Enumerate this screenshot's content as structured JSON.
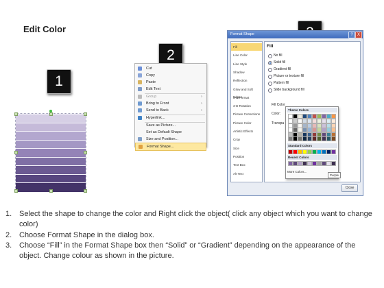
{
  "title": "Edit Color",
  "badges": [
    "1",
    "2",
    "3"
  ],
  "stack_colors": [
    "#d6cfe5",
    "#c5bad9",
    "#b3a7cf",
    "#a497c4",
    "#9483b7",
    "#7f6fa5",
    "#6b5a92",
    "#57467f",
    "#433368"
  ],
  "context_menu": {
    "items": [
      {
        "label": "Cut",
        "icon": "scissors-icon",
        "disabled": false,
        "submenu": false,
        "color": "#6b8fd8"
      },
      {
        "label": "Copy",
        "icon": "copy-icon",
        "disabled": false,
        "submenu": false,
        "color": "#8aa5d8"
      },
      {
        "label": "Paste",
        "icon": "paste-icon",
        "disabled": false,
        "submenu": false,
        "color": "#d8b460"
      },
      {
        "label": "Edit Text",
        "icon": "edit-text-icon",
        "disabled": false,
        "submenu": false,
        "color": "#7d9bc8"
      },
      {
        "label": "Group",
        "icon": "group-icon",
        "disabled": true,
        "submenu": true,
        "color": "#bbbbbb"
      },
      {
        "label": "Bring to Front",
        "icon": "bring-to-front-icon",
        "disabled": false,
        "submenu": true,
        "color": "#6f9ad0"
      },
      {
        "label": "Send to Back",
        "icon": "send-to-back-icon",
        "disabled": false,
        "submenu": true,
        "color": "#6f9ad0"
      },
      {
        "label": "Hyperlink...",
        "icon": "hyperlink-icon",
        "disabled": false,
        "submenu": false,
        "color": "#3f82c6"
      },
      {
        "label": "Save as Picture...",
        "icon": "",
        "disabled": false,
        "submenu": false,
        "color": ""
      },
      {
        "label": "Set as Default Shape",
        "icon": "",
        "disabled": false,
        "submenu": false,
        "color": ""
      },
      {
        "label": "Size and Position...",
        "icon": "size-position-icon",
        "disabled": false,
        "submenu": false,
        "color": "#7f9fc8"
      },
      {
        "label": "Format Shape...",
        "icon": "format-shape-icon",
        "disabled": false,
        "submenu": false,
        "highlight": true,
        "color": "#e0a040"
      }
    ]
  },
  "dialog": {
    "title": "Format Shape",
    "help_label": "?",
    "close_label": "X",
    "sidebar": [
      "Fill",
      "Line Color",
      "Line Style",
      "Shadow",
      "Reflection",
      "Glow and Soft Edges",
      "3-D Format",
      "3-D Rotation",
      "Picture Corrections",
      "Picture Color",
      "Artistic Effects",
      "Crop",
      "Size",
      "Position",
      "Text Box",
      "Alt Text"
    ],
    "selected_index": 0,
    "pane_heading": "Fill",
    "options": [
      "No fill",
      "Solid fill",
      "Gradient fill",
      "Picture or texture fill",
      "Pattern fill",
      "Slide background fill"
    ],
    "selected_option": 1,
    "fill_color_label": "Fill Color",
    "color_label": "Color:",
    "transparency_label": "Transpa",
    "close_button": "Close"
  },
  "picker": {
    "theme_heading": "Theme Colors",
    "standard_heading": "Standard Colors",
    "recent_heading": "Recent Colors",
    "more_label": "More Colors...",
    "tooltip": "Purple",
    "theme_top": [
      "#ffffff",
      "#000000",
      "#eeece1",
      "#1f497d",
      "#4f81bd",
      "#c0504d",
      "#9bbb59",
      "#8064a2",
      "#4bacc6",
      "#f79646"
    ],
    "standard": [
      "#c00000",
      "#ff0000",
      "#ffc000",
      "#ffff00",
      "#92d050",
      "#00b050",
      "#00b0f0",
      "#0070c0",
      "#002060",
      "#7030a0"
    ],
    "recent": [
      "#8064a2",
      "#5f497a",
      "#b2a1c7",
      "#403152",
      "#ccc1d9",
      "#7030a0",
      "#a5a5a5",
      "#604a7b",
      "#e5e0ec",
      "#3f3151"
    ]
  },
  "steps": [
    {
      "num": "1.",
      "text": "Select the shape to change the color and Right click the object( click any object which you want to change color)"
    },
    {
      "num": "2.",
      "text": "Choose Format Shape in the dialog box."
    },
    {
      "num": "3.",
      "text": "Choose “Fill” in the Format Shape box then “Solid” or “Gradient” depending on the appearance of the object. Change colour as shown in the picture."
    }
  ]
}
